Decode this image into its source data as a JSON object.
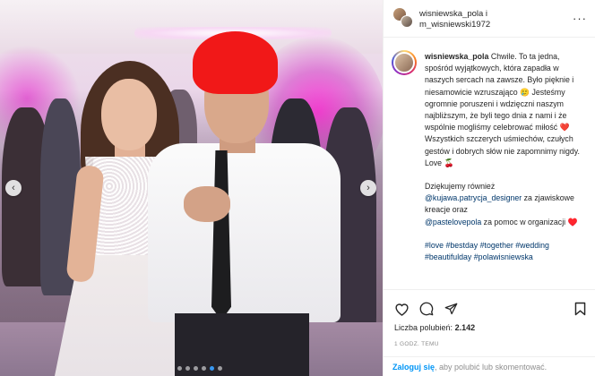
{
  "post": {
    "header": {
      "name_line1": "wisniewska_pola i",
      "name_line2": "m_wisniewski1972",
      "more_label": "···"
    },
    "caption": {
      "username": "wisniewska_pola",
      "paragraph1": "Chwile. To ta jedna, spośród wyjątkowych, która zapadła w naszych sercach na zawsze. Było pięknie i niesamowicie wzruszająco 🥲 Jesteśmy ogromnie poruszeni i wdzięczni naszym najbliższym, że byli tego dnia z nami i że wspólnie mogliśmy celebrować miłość ❤️ Wszystkich szczerych uśmiechów, czułych gestów i dobrych słów nie zapomnimy nigdy. Love 🍒",
      "thanks_prefix": "Dziękujemy również",
      "mention1": "@kujawa.patrycja_designer",
      "thanks_middle": " za zjawiskowe kreacje oraz",
      "mention2": "@pastelovepola",
      "thanks_suffix": " za pomoc w organizacji ♥️",
      "hashtags": "#love #bestday #together #wedding #beautifulday #polawisniewska"
    },
    "likes_label": "Liczba polubień:",
    "likes_count": "2.142",
    "time_label": "1 GODZ. TEMU",
    "login_link": "Zaloguj się",
    "login_text": ", aby polubić lub skomentować.",
    "carousel": {
      "prev_icon": "‹",
      "next_icon": "›",
      "dots": 6,
      "active_dot": 4
    }
  }
}
